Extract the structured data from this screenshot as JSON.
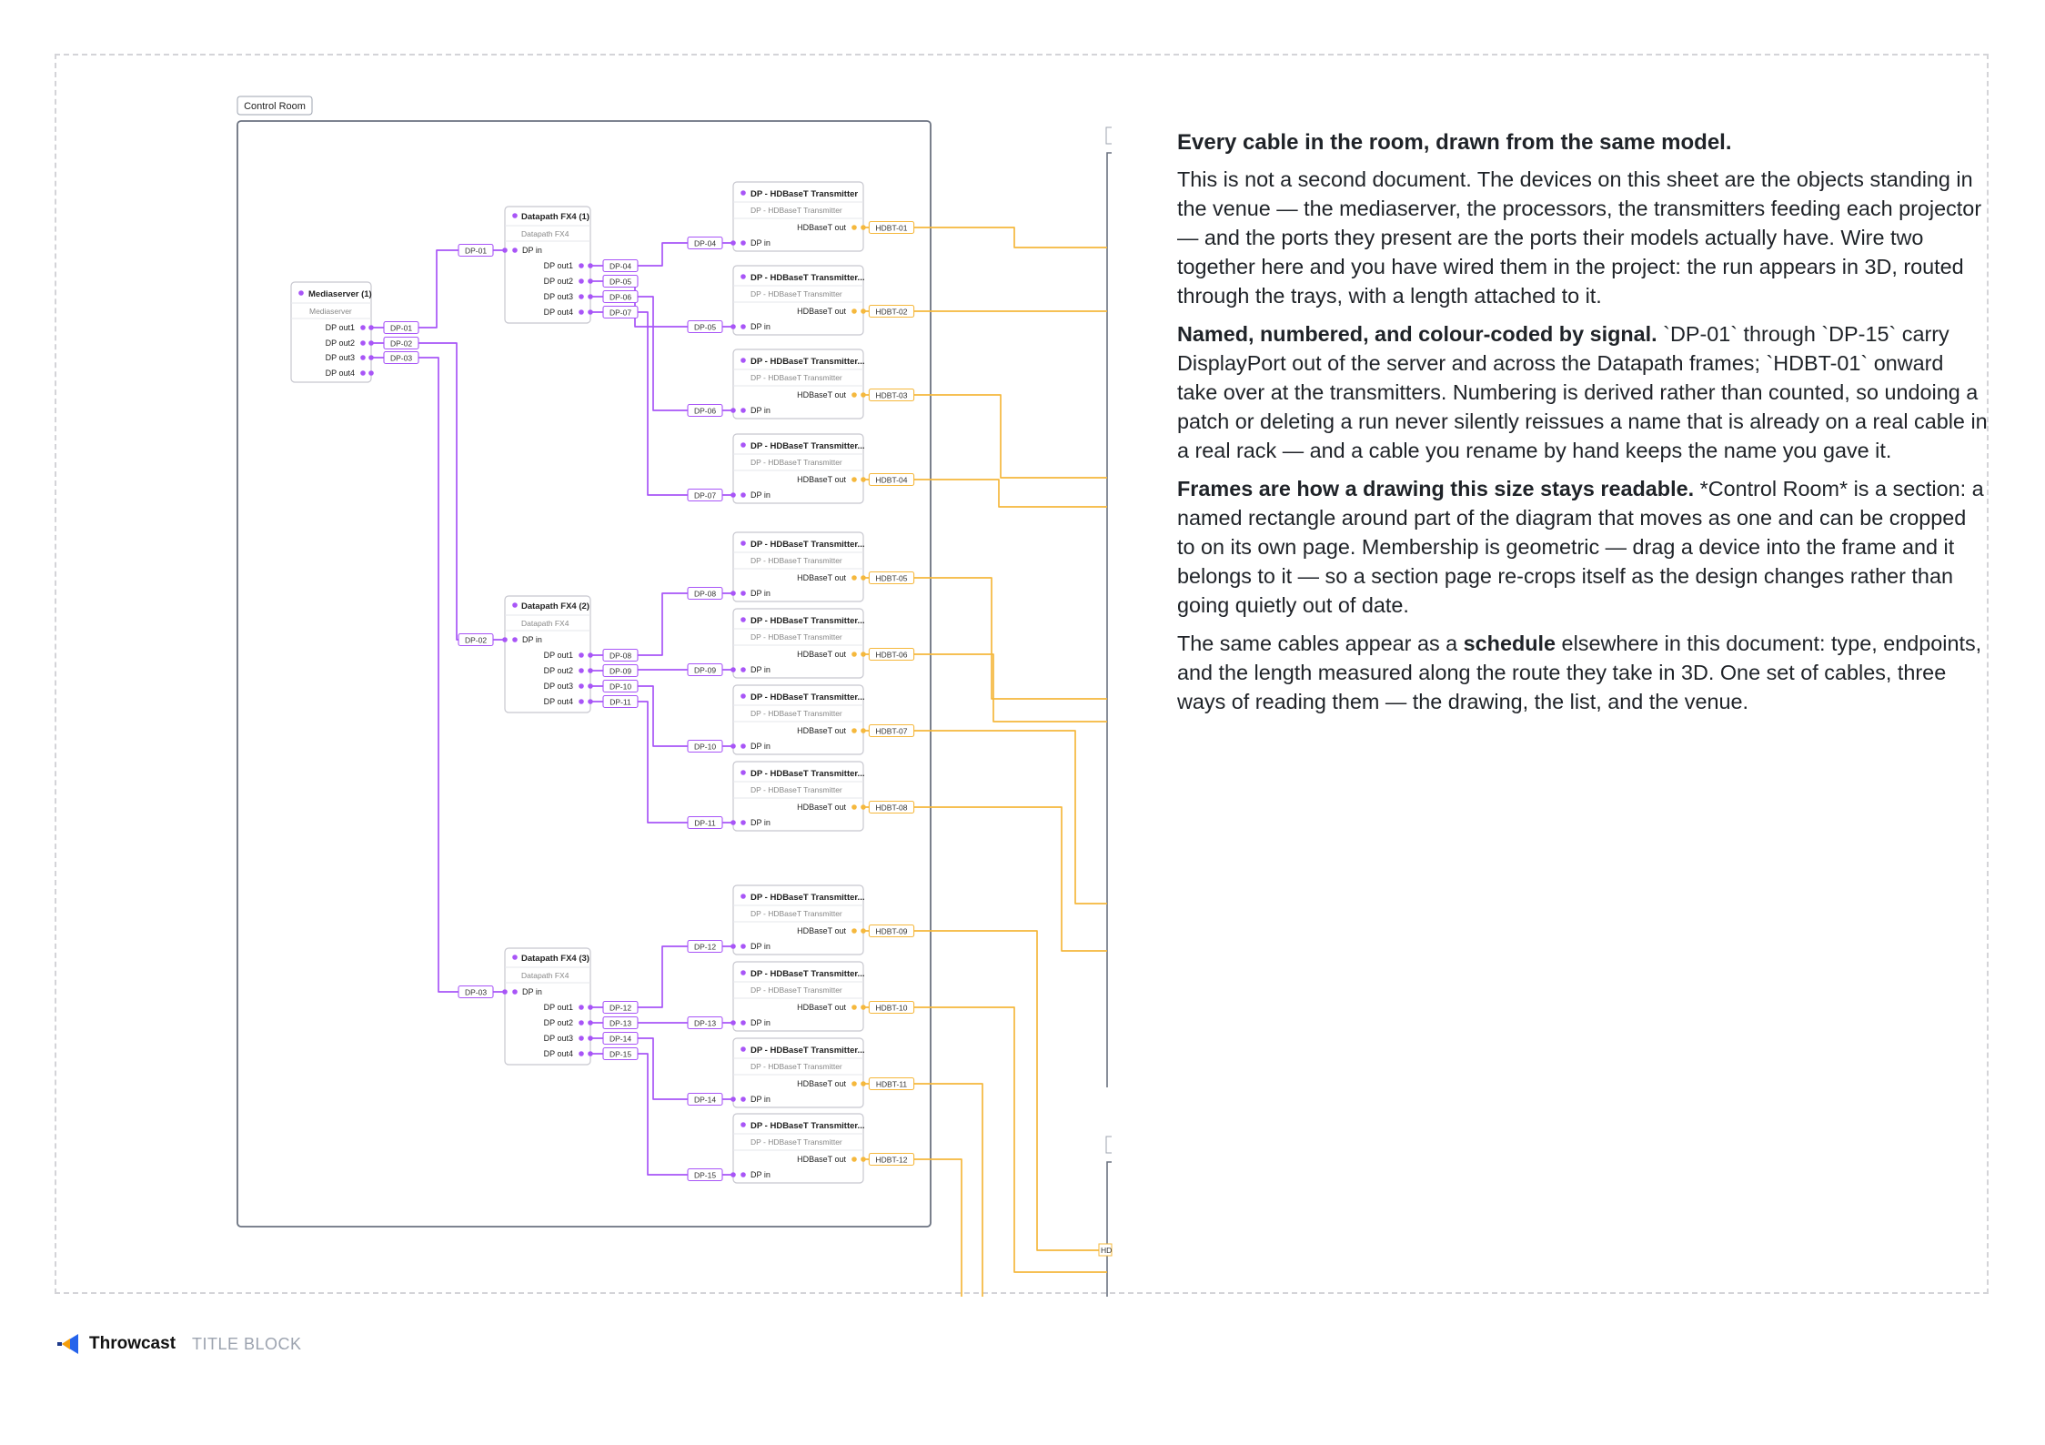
{
  "frame": {
    "label": "Control Room"
  },
  "mediaserver": {
    "title": "Mediaserver (1)",
    "subtitle": "Mediaserver",
    "ports": [
      "DP out1",
      "DP out2",
      "DP out3",
      "DP out4"
    ]
  },
  "processors": [
    {
      "title": "Datapath FX4 (1)",
      "subtitle": "Datapath FX4",
      "input": "DP in",
      "outputs": [
        "DP out1",
        "DP out2",
        "DP out3",
        "DP out4"
      ],
      "input_cable": "DP-01",
      "output_cables": [
        "DP-04",
        "DP-05",
        "DP-06",
        "DP-07"
      ]
    },
    {
      "title": "Datapath FX4 (2)",
      "subtitle": "Datapath FX4",
      "input": "DP in",
      "outputs": [
        "DP out1",
        "DP out2",
        "DP out3",
        "DP out4"
      ],
      "input_cable": "DP-02",
      "output_cables": [
        "DP-08",
        "DP-09",
        "DP-10",
        "DP-11"
      ]
    },
    {
      "title": "Datapath FX4 (3)",
      "subtitle": "Datapath FX4",
      "input": "DP in",
      "outputs": [
        "DP out1",
        "DP out2",
        "DP out3",
        "DP out4"
      ],
      "input_cable": "DP-03",
      "output_cables": [
        "DP-12",
        "DP-13",
        "DP-14",
        "DP-15"
      ]
    }
  ],
  "server_cables": [
    "DP-01",
    "DP-02",
    "DP-03"
  ],
  "transmitters": [
    {
      "title": "DP - HDBaseT Transmitter",
      "subtitle": "DP - HDBaseT Transmitter",
      "out_port": "HDBaseT out",
      "in_port": "DP in",
      "in_cable": "DP-04",
      "out_cable": "HDBT-01"
    },
    {
      "title": "DP - HDBaseT Transmitter...",
      "subtitle": "DP - HDBaseT Transmitter",
      "out_port": "HDBaseT out",
      "in_port": "DP in",
      "in_cable": "DP-05",
      "out_cable": "HDBT-02"
    },
    {
      "title": "DP - HDBaseT Transmitter...",
      "subtitle": "DP - HDBaseT Transmitter",
      "out_port": "HDBaseT out",
      "in_port": "DP in",
      "in_cable": "DP-06",
      "out_cable": "HDBT-03"
    },
    {
      "title": "DP - HDBaseT Transmitter...",
      "subtitle": "DP - HDBaseT Transmitter",
      "out_port": "HDBaseT out",
      "in_port": "DP in",
      "in_cable": "DP-07",
      "out_cable": "HDBT-04"
    },
    {
      "title": "DP - HDBaseT Transmitter...",
      "subtitle": "DP - HDBaseT Transmitter",
      "out_port": "HDBaseT out",
      "in_port": "DP in",
      "in_cable": "DP-08",
      "out_cable": "HDBT-05"
    },
    {
      "title": "DP - HDBaseT Transmitter...",
      "subtitle": "DP - HDBaseT Transmitter",
      "out_port": "HDBaseT out",
      "in_port": "DP in",
      "in_cable": "DP-09",
      "out_cable": "HDBT-06"
    },
    {
      "title": "DP - HDBaseT Transmitter...",
      "subtitle": "DP - HDBaseT Transmitter",
      "out_port": "HDBaseT out",
      "in_port": "DP in",
      "in_cable": "DP-10",
      "out_cable": "HDBT-07"
    },
    {
      "title": "DP - HDBaseT Transmitter...",
      "subtitle": "DP - HDBaseT Transmitter",
      "out_port": "HDBaseT out",
      "in_port": "DP in",
      "in_cable": "DP-11",
      "out_cable": "HDBT-08"
    },
    {
      "title": "DP - HDBaseT Transmitter...",
      "subtitle": "DP - HDBaseT Transmitter",
      "out_port": "HDBaseT out",
      "in_port": "DP in",
      "in_cable": "DP-12",
      "out_cable": "HDBT-09"
    },
    {
      "title": "DP - HDBaseT Transmitter...",
      "subtitle": "DP - HDBaseT Transmitter",
      "out_port": "HDBaseT out",
      "in_port": "DP in",
      "in_cable": "DP-13",
      "out_cable": "HDBT-10"
    },
    {
      "title": "DP - HDBaseT Transmitter...",
      "subtitle": "DP - HDBaseT Transmitter",
      "out_port": "HDBaseT out",
      "in_port": "DP in",
      "in_cable": "DP-14",
      "out_cable": "HDBT-11"
    },
    {
      "title": "DP - HDBaseT Transmitter...",
      "subtitle": "DP - HDBaseT Transmitter",
      "out_port": "HDBaseT out",
      "in_port": "DP in",
      "in_cable": "DP-15",
      "out_cable": "HDBT-12"
    }
  ],
  "partial_label": "HD",
  "colors": {
    "displayport": "#a855f7",
    "hdbaset": "#f5b83d",
    "frame_border": "#6b7280"
  },
  "text": {
    "heading": "Every cable in the room, drawn from the same model.",
    "p1": "This is not a second document. The devices on this sheet are the objects standing in the venue — the mediaserver, the processors, the transmitters feeding each projector — and the ports they present are the ports their models actually have. Wire two together here and you have wired them in the project: the run appears in 3D, routed through the trays, with a length attached to it.",
    "p2_bold": "Named, numbered, and colour-coded by signal.",
    "p2": " `DP-01` through `DP-15` carry DisplayPort out of the server and across the Datapath frames; `HDBT-01` onward take over at the transmitters. Numbering is derived rather than counted, so undoing a patch or deleting a run never silently reissues a name that is already on a real cable in a real rack — and a cable you rename by hand keeps the name you gave it.",
    "p3_bold": "Frames are how a drawing this size stays readable.",
    "p3": " *Control Room* is a section: a named rectangle around part of the diagram that moves as one and can be cropped to on its own page. Membership is geometric — drag a device into the frame and it belongs to it — so a section page re-crops itself as the design changes rather than going quietly out of date.",
    "p4_a": "The same cables appear as a ",
    "p4_bold": "schedule",
    "p4_b": " elsewhere in this document: type, endpoints, and the length measured along the route they take in 3D. One set of cables, three ways of reading them — the drawing, the list, and the venue."
  },
  "footer": {
    "brand": "Throwcast",
    "title_block": "TITLE BLOCK",
    "logo_icon": "throwcast-logo-icon"
  }
}
